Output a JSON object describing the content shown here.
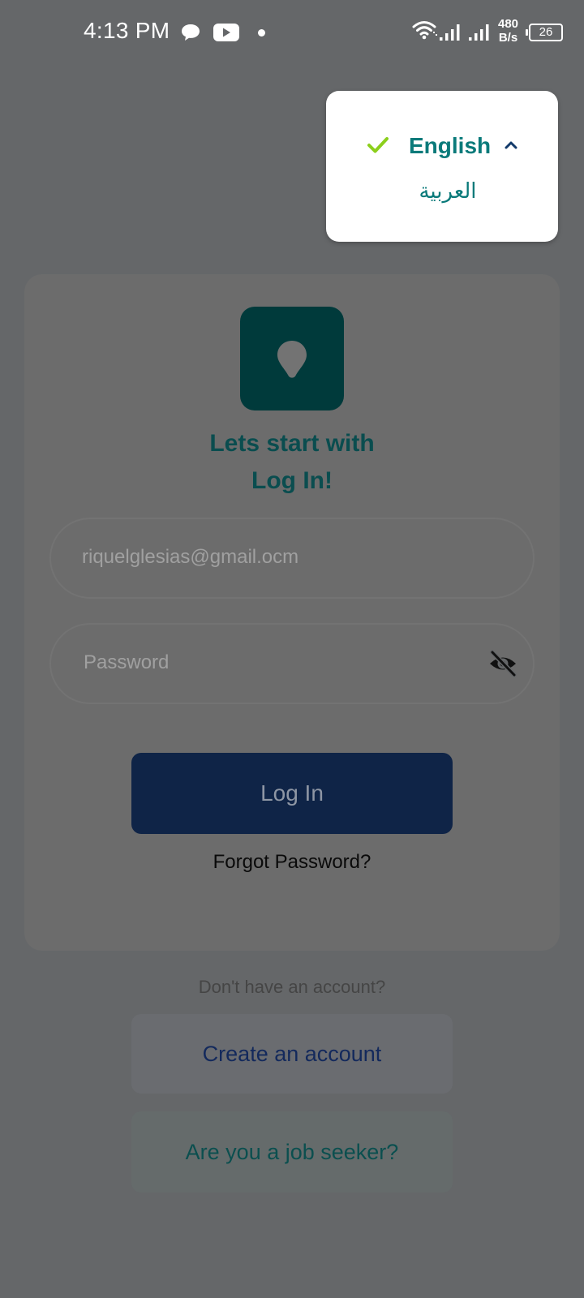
{
  "status_bar": {
    "time": "4:13 PM",
    "speed_value": "480",
    "speed_unit": "B/s",
    "battery": "26",
    "icons": [
      "chat-icon",
      "youtube-icon",
      "dot-icon",
      "wifi-icon",
      "signal-icon",
      "signal-icon"
    ]
  },
  "language_menu": {
    "selected": "English",
    "options": [
      "English",
      "العربية"
    ]
  },
  "login": {
    "heading_line1": "Lets start with",
    "heading_line2": "Log In!",
    "email_value": "riquelglesias@gmail.ocm",
    "password_placeholder": "Password",
    "login_button": "Log In",
    "forgot_password": "Forgot Password?"
  },
  "signup": {
    "prompt": "Don't have an account?",
    "create_account": "Create an account",
    "job_seeker": "Are you a job seeker?"
  },
  "colors": {
    "overlay": "#656769",
    "brand_teal": "#003a3b",
    "primary_navy": "#0f2447",
    "accent_green": "#8ccf1c",
    "link_teal": "#0a7a7a"
  }
}
